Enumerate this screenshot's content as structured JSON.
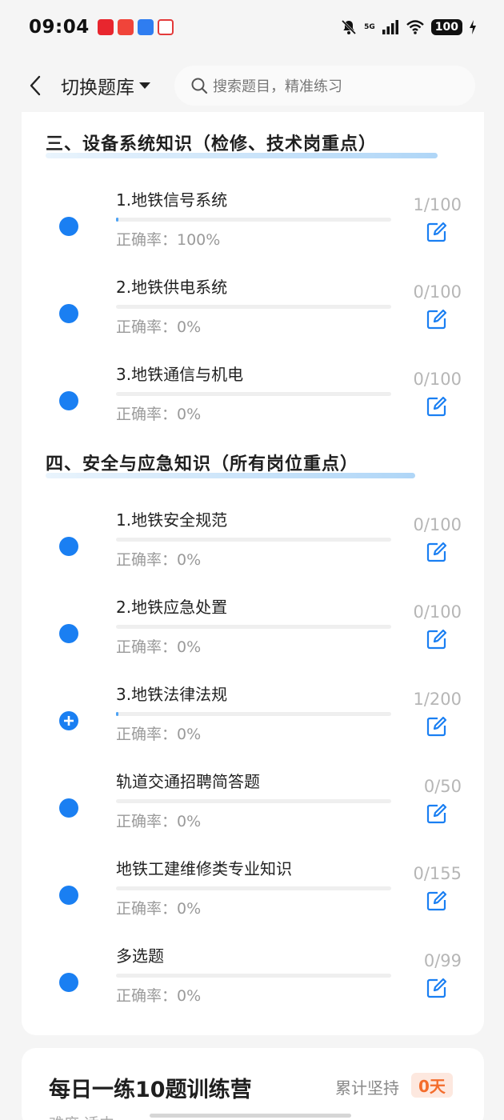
{
  "status_bar": {
    "time": "09:04",
    "network": "5G",
    "battery": "100"
  },
  "nav": {
    "switch_bank_label": "切换题库",
    "search_placeholder": "搜索题目，精准练习"
  },
  "sections": [
    {
      "title": "三、设备系统知识（检修、技术岗重点）",
      "items": [
        {
          "name": "1.地铁信号系统",
          "accuracy": "正确率：100%",
          "progress": "1/100",
          "done": 1,
          "total": 100,
          "icon": "dot"
        },
        {
          "name": "2.地铁供电系统",
          "accuracy": "正确率：0%",
          "progress": "0/100",
          "done": 0,
          "total": 100,
          "icon": "dot"
        },
        {
          "name": "3.地铁通信与机电",
          "accuracy": "正确率：0%",
          "progress": "0/100",
          "done": 0,
          "total": 100,
          "icon": "dot"
        }
      ]
    },
    {
      "title": "四、安全与应急知识（所有岗位重点）",
      "items": [
        {
          "name": "1.地铁安全规范",
          "accuracy": "正确率：0%",
          "progress": "0/100",
          "done": 0,
          "total": 100,
          "icon": "dot"
        },
        {
          "name": "2.地铁应急处置",
          "accuracy": "正确率：0%",
          "progress": "0/100",
          "done": 0,
          "total": 100,
          "icon": "dot"
        },
        {
          "name": "3.地铁法律法规",
          "accuracy": "正确率：0%",
          "progress": "1/200",
          "done": 1,
          "total": 200,
          "icon": "plus"
        },
        {
          "name": "轨道交通招聘简答题",
          "accuracy": "正确率：0%",
          "progress": "0/50",
          "done": 0,
          "total": 50,
          "icon": "dot"
        },
        {
          "name": "地铁工建维修类专业知识",
          "accuracy": "正确率：0%",
          "progress": "0/155",
          "done": 0,
          "total": 155,
          "icon": "dot"
        },
        {
          "name": "多选题",
          "accuracy": "正确率：0%",
          "progress": "0/99",
          "done": 0,
          "total": 99,
          "icon": "dot"
        }
      ]
    }
  ],
  "camp": {
    "title": "每日一练10题训练营",
    "streak_label": "累计坚持",
    "streak_value": "0天",
    "sub": "难度 适中"
  },
  "colors": {
    "accent": "#1a7ff2",
    "bar_fill": "#4da3f5",
    "streak": "#f36c2c"
  }
}
